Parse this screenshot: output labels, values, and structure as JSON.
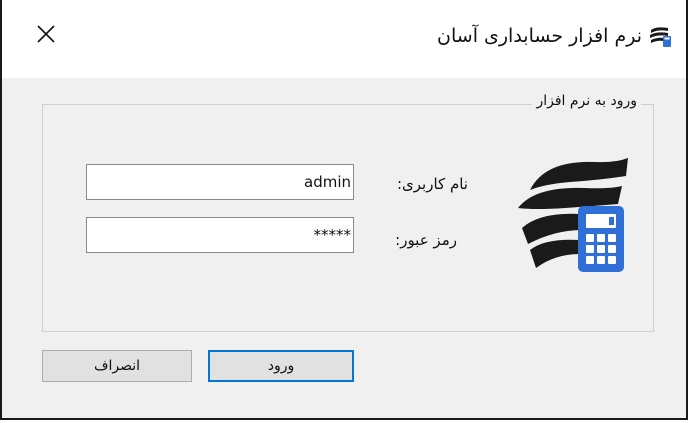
{
  "window": {
    "title": "نرم افزار حسابداری آسان",
    "close_glyph": "✕",
    "icons": {
      "app": "app-logo-icon",
      "close": "close-icon"
    }
  },
  "login": {
    "group_title": "ورود به نرم افزار",
    "username_label": "نام کاربری:",
    "username_value": "admin",
    "password_label": "رمز عبور:",
    "password_value": "*****",
    "logo_icon": "accounting-calculator-logo-icon"
  },
  "buttons": {
    "login_label": "ورود",
    "cancel_label": "انصراف"
  },
  "colors": {
    "selection": "#3a7bd5",
    "primary_border": "#0078d7",
    "logo_dark": "#1a1a1a",
    "calculator_blue": "#2f6fd6"
  }
}
